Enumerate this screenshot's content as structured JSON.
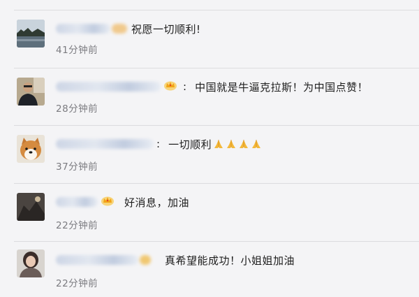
{
  "comments": [
    {
      "text": "祝愿一切顺利!",
      "time": "41分钟前",
      "avatar_icon": "user-avatar-lake-icon"
    },
    {
      "text": "中国就是牛逼克拉斯！为中国点赞！",
      "time": "28分钟前",
      "avatar_icon": "user-avatar-man-icon"
    },
    {
      "text": "一切顺利",
      "time": "37分钟前",
      "avatar_icon": "user-avatar-dog-icon",
      "emojis": [
        "pray-icon",
        "pray-icon",
        "pray-icon",
        "pray-icon"
      ]
    },
    {
      "text": "好消息，加油",
      "time": "22分钟前",
      "avatar_icon": "user-avatar-dark-icon"
    },
    {
      "text": "真希望能成功！小姐姐加油",
      "time": "22分钟前",
      "avatar_icon": "user-avatar-woman-icon"
    }
  ],
  "colors": {
    "background": "#f4f4f6",
    "divider": "#dcdcdf",
    "time": "#7b7b80",
    "text": "#1e1e1e",
    "crown": "#f2b01e"
  }
}
